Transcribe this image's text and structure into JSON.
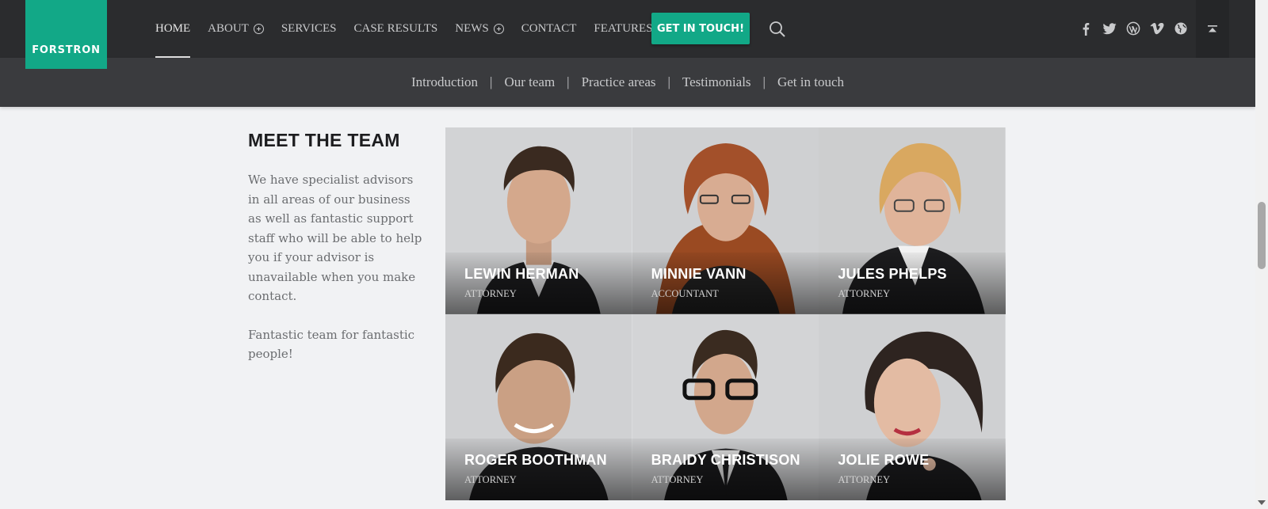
{
  "brand": {
    "logo_text": "FORSTRON",
    "accent": "#12a887"
  },
  "nav": {
    "items": [
      {
        "label": "HOME",
        "has_plus": false,
        "active": true
      },
      {
        "label": "ABOUT",
        "has_plus": true
      },
      {
        "label": "SERVICES",
        "has_plus": false
      },
      {
        "label": "CASE RESULTS",
        "has_plus": false
      },
      {
        "label": "NEWS",
        "has_plus": true
      },
      {
        "label": "CONTACT",
        "has_plus": false
      },
      {
        "label": "FEATURES",
        "has_plus": true
      }
    ],
    "cta_label": "GET IN TOUCH!",
    "social_icons": [
      "facebook-icon",
      "twitter-icon",
      "wordpress-icon",
      "vimeo-icon",
      "globe-icon"
    ]
  },
  "subnav": {
    "links": [
      "Introduction",
      "Our team",
      "Practice areas",
      "Testimonials",
      "Get in touch"
    ],
    "separator": "|"
  },
  "section": {
    "title": "MEET THE TEAM",
    "paragraph1": "We have specialist advisors in all areas of our business as well as fantastic support staff who will be able to help you if your advisor is unavailable when you make contact.",
    "paragraph2": "Fantastic team for fantastic people!"
  },
  "team": [
    {
      "name": "LEWIN HERMAN",
      "role": "ATTORNEY"
    },
    {
      "name": "MINNIE VANN",
      "role": "ACCOUNTANT"
    },
    {
      "name": "JULES PHELPS",
      "role": "ATTORNEY"
    },
    {
      "name": "ROGER BOOTHMAN",
      "role": "ATTORNEY"
    },
    {
      "name": "BRAIDY CHRISTISON",
      "role": "ATTORNEY"
    },
    {
      "name": "JOLIE ROWE",
      "role": "ATTORNEY"
    }
  ]
}
